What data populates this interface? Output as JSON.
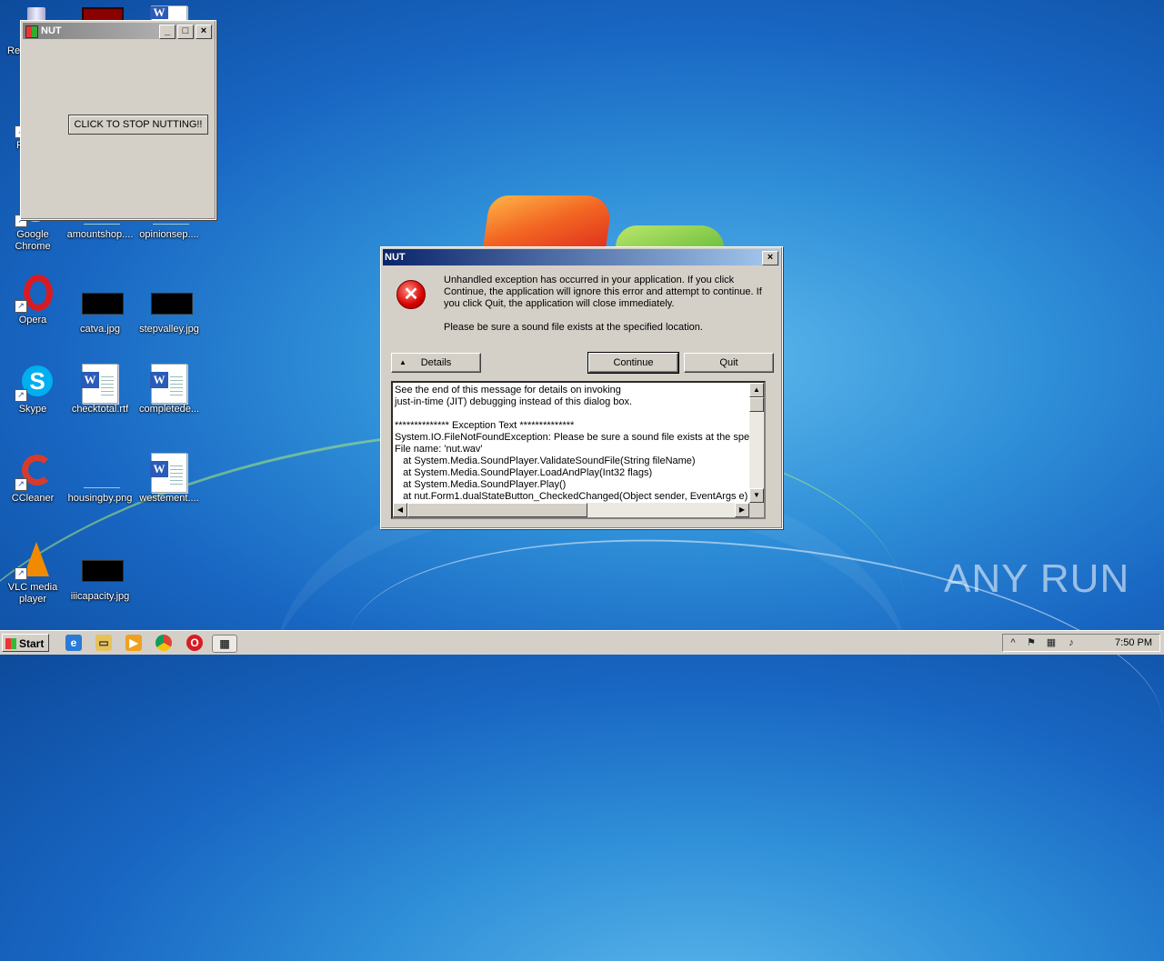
{
  "desktop": {
    "icons": [
      {
        "id": "recycle",
        "label": "Re"
      },
      {
        "id": "chrome",
        "label": "Google Chrome"
      },
      {
        "id": "amountshop",
        "label": "amountshop...."
      },
      {
        "id": "opinionsep",
        "label": "opinionsep...."
      },
      {
        "id": "opera",
        "label": "Opera"
      },
      {
        "id": "catva",
        "label": "catva.jpg"
      },
      {
        "id": "stepvalley",
        "label": "stepvalley.jpg"
      },
      {
        "id": "skype",
        "label": "Skype"
      },
      {
        "id": "checktotal",
        "label": "checktotal.rtf"
      },
      {
        "id": "completede",
        "label": "completede..."
      },
      {
        "id": "ccleaner",
        "label": "CCleaner"
      },
      {
        "id": "housingby",
        "label": "housingby.png"
      },
      {
        "id": "westement",
        "label": "westement...."
      },
      {
        "id": "vlc",
        "label": "VLC media player"
      },
      {
        "id": "iiicapacity",
        "label": "iiicapacity.jpg"
      }
    ],
    "partial_label_f": "F"
  },
  "nut_window": {
    "title": "NUT",
    "button_label": "CLICK TO STOP NUTTING!!"
  },
  "error_dialog": {
    "title": "NUT",
    "message_1": "Unhandled exception has occurred in your application. If you click Continue, the application will ignore this error and attempt to continue. If you click Quit, the application will close immediately.",
    "message_2": "Please be sure a sound file exists at the specified location.",
    "details_label": "Details",
    "continue_label": "Continue",
    "quit_label": "Quit",
    "details_text": "See the end of this message for details on invoking\njust-in-time (JIT) debugging instead of this dialog box.\n\n************** Exception Text **************\nSystem.IO.FileNotFoundException: Please be sure a sound file exists at the specified\nFile name: 'nut.wav'\n   at System.Media.SoundPlayer.ValidateSoundFile(String fileName)\n   at System.Media.SoundPlayer.LoadAndPlay(Int32 flags)\n   at System.Media.SoundPlayer.Play()\n   at nut.Form1.dualStateButton_CheckedChanged(Object sender, EventArgs e)"
  },
  "taskbar": {
    "start_label": "Start",
    "clock": "7:50 PM"
  },
  "watermark": "ANY RUN"
}
